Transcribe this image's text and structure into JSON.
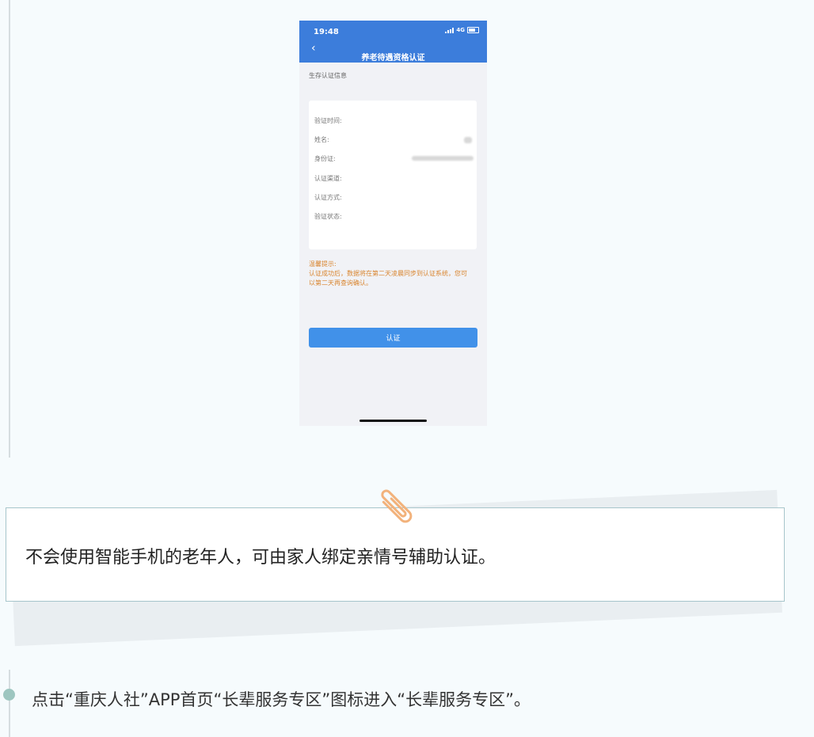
{
  "phone": {
    "status": {
      "time": "19:48",
      "network": "4G"
    },
    "title": "养老待遇资格认证",
    "section_label": "生存认证信息",
    "fields": [
      {
        "label": "验证时间:"
      },
      {
        "label": "姓名:"
      },
      {
        "label": "身份证:"
      },
      {
        "label": "认证渠道:"
      },
      {
        "label": "认证方式:"
      },
      {
        "label": "验证状态:"
      }
    ],
    "tip_title": "温馨提示:",
    "tip_lines": [
      "认证成功后，数据将在第二天凌晨同步到认证系统，您可",
      "以第二天再查询确认。"
    ],
    "button_label": "认证"
  },
  "tip_box": {
    "text": "不会使用智能手机的老年人，可由家人绑定亲情号辅助认证。"
  },
  "step": {
    "text": "点击“重庆人社”APP首页“长辈服务专区”图标进入“长辈服务专区”。"
  },
  "colors": {
    "header_blue": "#3c7ddb",
    "button_blue": "#4191e9",
    "tip_orange": "#d9852f",
    "clip_orange": "#f2b27b",
    "box_border": "#a6c5cb",
    "dot_teal": "#9dc6c0"
  }
}
